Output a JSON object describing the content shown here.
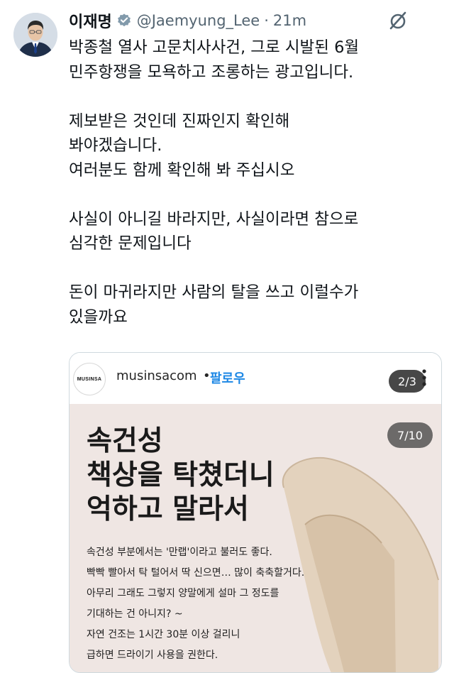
{
  "tweet": {
    "author_name": "이재명",
    "handle": "@Jaemyung_Lee",
    "separator": "·",
    "time": "21m",
    "text_lines": [
      "박종철 열사 고문치사사건, 그로 시발된 6월",
      "민주항쟁을 모욕하고 조롱하는 광고입니다.",
      "",
      "제보받은 것인데 진짜인지 확인해",
      "봐야겠습니다.",
      "여러분도 함께 확인해 봐 주십시오",
      "",
      "사실이 아니길 바라지만, 사실이라면 참으로",
      "심각한 문제입니다",
      "",
      "돈이 마귀라지만 사람의 탈을 쓰고 이럴수가",
      "있을까요"
    ]
  },
  "embed": {
    "logo_text": "MUSINSA",
    "account": "musinsacom",
    "dot": "•",
    "follow_label": "팔로우",
    "counter_outer": "2/3",
    "counter_inner": "7/10",
    "headline": [
      "속건성",
      "책상을 탁쳤더니",
      "억하고 말라서"
    ],
    "caption_lines": [
      "속건성 부분에서는 '만랩'이라고 불러도 좋다.",
      "빡빡 빨아서 탁 털어서 딱 신으면… 많이 축축할거다.",
      "아무리 그래도 그렇지 양말에게 설마 그 정도를",
      "기대하는 건 아니지? ~",
      "자연 건조는 1시간 30분 이상 걸리니",
      "급하면 드라이기 사용을 권한다."
    ]
  },
  "colors": {
    "text": "#0f1419",
    "muted": "#536471",
    "verified": "#829aab",
    "follow": "#1e88e5",
    "photo_bg": "#efe6e3",
    "sock": "#e3d2bd"
  },
  "icons": {
    "verified": "verified-badge-icon",
    "mute": "mute-icon",
    "more": "more-vertical-icon"
  }
}
